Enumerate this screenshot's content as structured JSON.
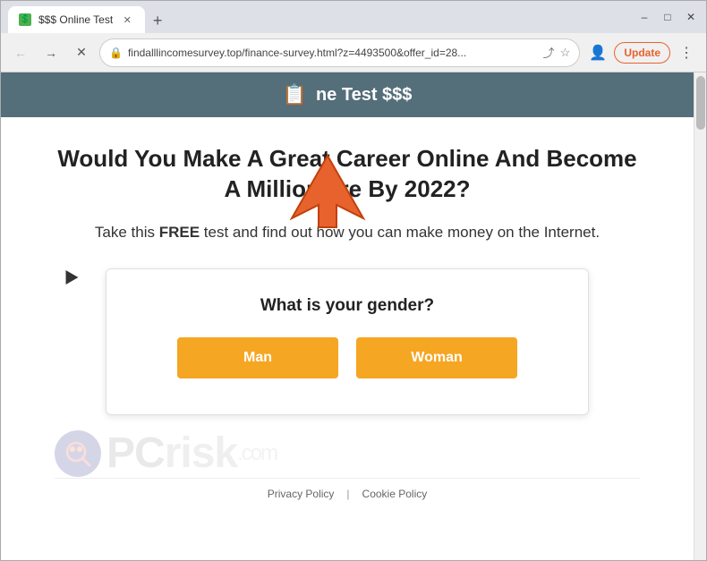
{
  "browser": {
    "tab": {
      "title": "$$$ Online Test",
      "favicon": "💲"
    },
    "address": "findalllincomesurvey.top/finance-survey.html?z=4493500&offer_id=28...",
    "update_button": "Update"
  },
  "site": {
    "title": "ne Test $$$",
    "header_icon": "📋"
  },
  "page": {
    "headline": "Would You Make A Great Career Online And Become A Millionaire By 2022?",
    "subheadline_part1": "Take this ",
    "subheadline_free": "FREE",
    "subheadline_part2": " test and find out how you can make money on the Internet.",
    "survey": {
      "question": "What is your gender?",
      "man_button": "Man",
      "woman_button": "Woman"
    }
  },
  "footer": {
    "privacy_link": "Privacy Policy",
    "cookie_link": "Cookie Policy"
  }
}
